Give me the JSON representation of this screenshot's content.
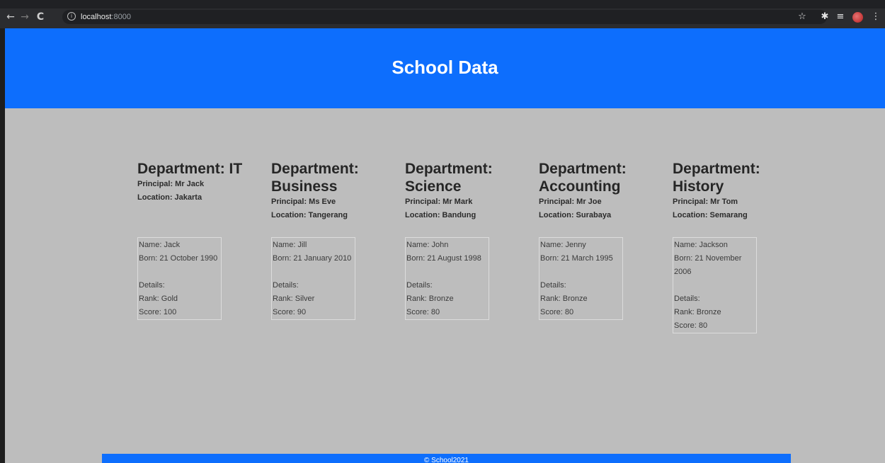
{
  "browser": {
    "back_icon": "←",
    "forward_icon": "→",
    "reload_icon": "C",
    "url_host": "localhost",
    "url_port": ":8000",
    "star_icon": "☆",
    "extensions_icon": "✱",
    "reading_list_icon": "≡",
    "menu_icon": "⋮"
  },
  "header": {
    "title": "School Data"
  },
  "departments": [
    {
      "title": "Department: IT",
      "principal": "Principal: Mr Jack",
      "location": "Location: Jakarta",
      "student": {
        "name": "Name: Jack",
        "born": "Born: 21 October 1990",
        "details_label": "Details:",
        "rank": "Rank: Gold",
        "score": "Score: 100"
      }
    },
    {
      "title": "Department: Business",
      "principal": "Principal: Ms Eve",
      "location": "Location: Tangerang",
      "student": {
        "name": "Name: Jill",
        "born": "Born: 21 January 2010",
        "details_label": "Details:",
        "rank": "Rank: Silver",
        "score": "Score: 90"
      }
    },
    {
      "title": "Department: Science",
      "principal": "Principal: Mr Mark",
      "location": "Location: Bandung",
      "student": {
        "name": "Name: John",
        "born": "Born: 21 August 1998",
        "details_label": "Details:",
        "rank": "Rank: Bronze",
        "score": "Score: 80"
      }
    },
    {
      "title": "Department: Accounting",
      "principal": "Principal: Mr Joe",
      "location": "Location: Surabaya",
      "student": {
        "name": "Name: Jenny",
        "born": "Born: 21 March 1995",
        "details_label": "Details:",
        "rank": "Rank: Bronze",
        "score": "Score: 80"
      }
    },
    {
      "title": "Department: History",
      "principal": "Principal: Mr Tom",
      "location": "Location: Semarang",
      "student": {
        "name": "Name: Jackson",
        "born": "Born: 21 November 2006",
        "details_label": "Details:",
        "rank": "Rank: Bronze",
        "score": "Score: 80"
      }
    }
  ],
  "footer": {
    "text": "© School2021"
  },
  "colors": {
    "primary": "#0d6efd",
    "page_bg": "#bdbdbd",
    "chrome_bg": "#202124"
  }
}
